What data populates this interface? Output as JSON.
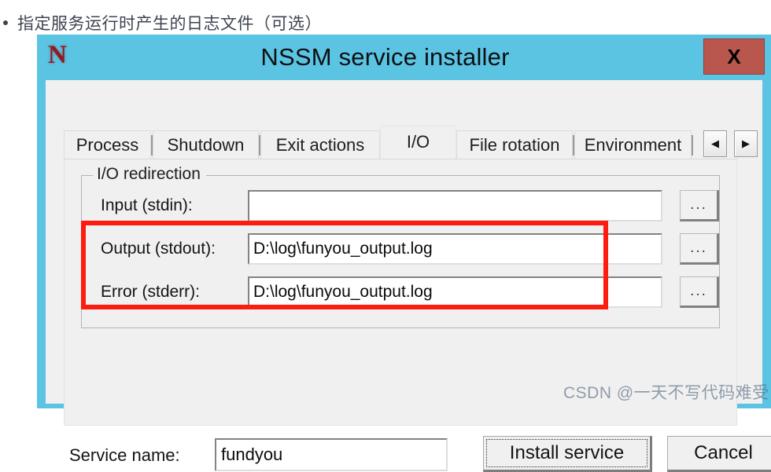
{
  "article": {
    "bullet_text": "指定服务运行时产生的日志文件（可选）"
  },
  "window": {
    "logo": "N",
    "title": "NSSM service installer",
    "close_label": "X",
    "titlebar_color": "#5bc4e3",
    "close_color": "#b9574e"
  },
  "tabs": {
    "items": [
      {
        "label": "Process",
        "selected": false
      },
      {
        "label": "Shutdown",
        "selected": false
      },
      {
        "label": "Exit actions",
        "selected": false
      },
      {
        "label": "I/O",
        "selected": true
      },
      {
        "label": "File rotation",
        "selected": false
      },
      {
        "label": "Environment",
        "selected": false
      }
    ],
    "scroll_left": "◀",
    "scroll_right": "▶"
  },
  "io_group": {
    "legend": "I/O redirection",
    "fields": [
      {
        "label": "Input (stdin):",
        "value": "",
        "placeholder": "",
        "browse": "..."
      },
      {
        "label": "Output (stdout):",
        "value": "D:\\log\\funyou_output.log",
        "placeholder": "",
        "browse": "..."
      },
      {
        "label": "Error (stderr):",
        "value": "D:\\log\\funyou_output.log",
        "placeholder": "",
        "browse": "..."
      }
    ],
    "highlight_color": "#fc1d10"
  },
  "bottom": {
    "service_name_label": "Service name:",
    "service_name_value": "fundyou",
    "service_name_placeholder": "",
    "install_label": "Install service",
    "cancel_label": "Cancel"
  },
  "watermark": {
    "text": "CSDN @一天不写代码难受"
  }
}
